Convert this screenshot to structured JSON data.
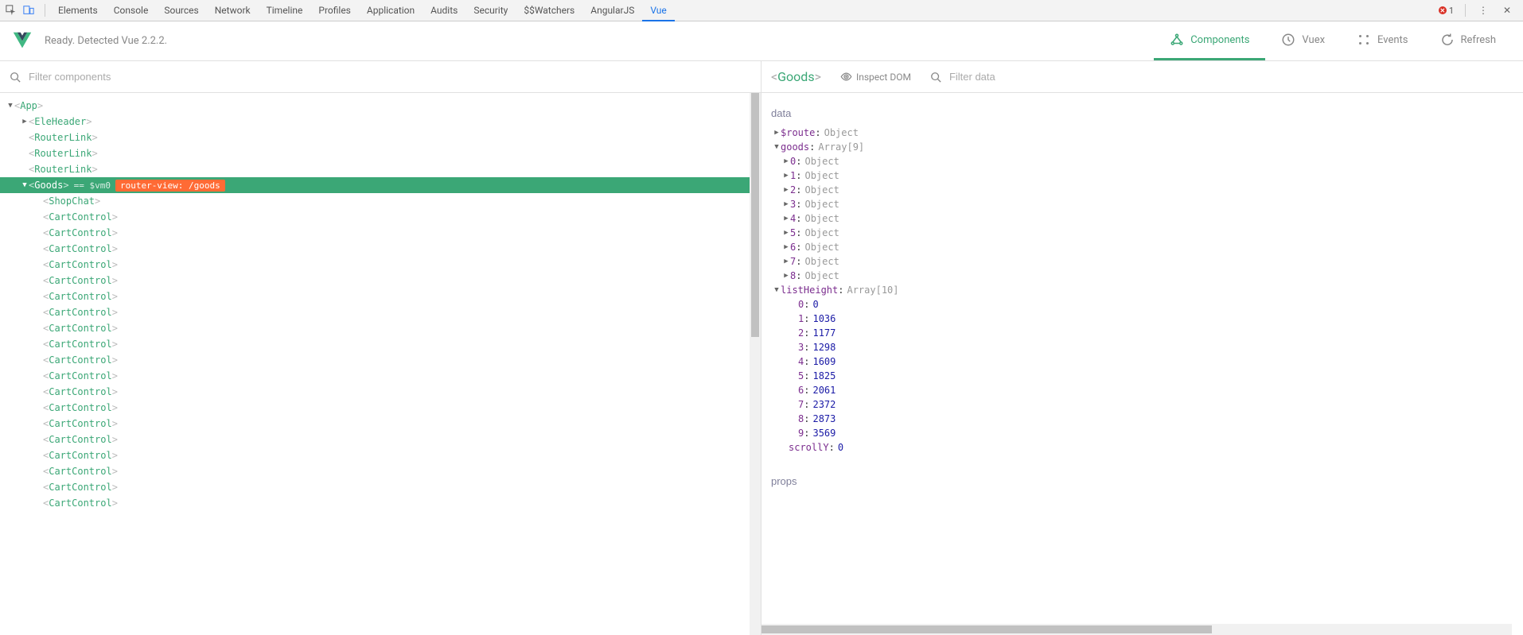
{
  "devtoolsTabs": {
    "items": [
      "Elements",
      "Console",
      "Sources",
      "Network",
      "Timeline",
      "Profiles",
      "Application",
      "Audits",
      "Security",
      "$$Watchers",
      "AngularJS",
      "Vue"
    ],
    "active": "Vue",
    "errorCount": "1"
  },
  "vueBar": {
    "status": "Ready. Detected Vue 2.2.2.",
    "tabs": {
      "components": "Components",
      "vuex": "Vuex",
      "events": "Events",
      "refresh": "Refresh"
    }
  },
  "leftPanel": {
    "filterPlaceholder": "Filter components"
  },
  "componentTree": {
    "root": {
      "name": "App",
      "indent": 8
    },
    "items": [
      {
        "name": "EleHeader",
        "indent": 26,
        "expandable": true
      },
      {
        "name": "RouterLink",
        "indent": 26
      },
      {
        "name": "RouterLink",
        "indent": 26
      },
      {
        "name": "RouterLink",
        "indent": 26
      }
    ],
    "selected": {
      "name": "Goods",
      "vm": "== $vm0",
      "route": "router-view: /goods",
      "indent": 26
    },
    "children": [
      {
        "name": "ShopChat",
        "indent": 44
      },
      {
        "name": "CartControl",
        "indent": 44
      },
      {
        "name": "CartControl",
        "indent": 44
      },
      {
        "name": "CartControl",
        "indent": 44
      },
      {
        "name": "CartControl",
        "indent": 44
      },
      {
        "name": "CartControl",
        "indent": 44
      },
      {
        "name": "CartControl",
        "indent": 44
      },
      {
        "name": "CartControl",
        "indent": 44
      },
      {
        "name": "CartControl",
        "indent": 44
      },
      {
        "name": "CartControl",
        "indent": 44
      },
      {
        "name": "CartControl",
        "indent": 44
      },
      {
        "name": "CartControl",
        "indent": 44
      },
      {
        "name": "CartControl",
        "indent": 44
      },
      {
        "name": "CartControl",
        "indent": 44
      },
      {
        "name": "CartControl",
        "indent": 44
      },
      {
        "name": "CartControl",
        "indent": 44
      },
      {
        "name": "CartControl",
        "indent": 44
      },
      {
        "name": "CartControl",
        "indent": 44
      },
      {
        "name": "CartControl",
        "indent": 44
      },
      {
        "name": "CartControl",
        "indent": 44
      }
    ]
  },
  "rightPanel": {
    "title": "Goods",
    "inspectLabel": "Inspect DOM",
    "filterPlaceholder": "Filter data"
  },
  "inspector": {
    "dataTitle": "data",
    "propsTitle": "props",
    "route": {
      "key": "$route",
      "val": "Object"
    },
    "goods": {
      "key": "goods",
      "val": "Array[9]",
      "items": [
        {
          "idx": "0",
          "val": "Object"
        },
        {
          "idx": "1",
          "val": "Object"
        },
        {
          "idx": "2",
          "val": "Object"
        },
        {
          "idx": "3",
          "val": "Object"
        },
        {
          "idx": "4",
          "val": "Object"
        },
        {
          "idx": "5",
          "val": "Object"
        },
        {
          "idx": "6",
          "val": "Object"
        },
        {
          "idx": "7",
          "val": "Object"
        },
        {
          "idx": "8",
          "val": "Object"
        }
      ]
    },
    "listHeight": {
      "key": "listHeight",
      "val": "Array[10]",
      "items": [
        {
          "idx": "0",
          "val": "0"
        },
        {
          "idx": "1",
          "val": "1036"
        },
        {
          "idx": "2",
          "val": "1177"
        },
        {
          "idx": "3",
          "val": "1298"
        },
        {
          "idx": "4",
          "val": "1609"
        },
        {
          "idx": "5",
          "val": "1825"
        },
        {
          "idx": "6",
          "val": "2061"
        },
        {
          "idx": "7",
          "val": "2372"
        },
        {
          "idx": "8",
          "val": "2873"
        },
        {
          "idx": "9",
          "val": "3569"
        }
      ]
    },
    "scrollY": {
      "key": "scrollY",
      "val": "0"
    }
  }
}
